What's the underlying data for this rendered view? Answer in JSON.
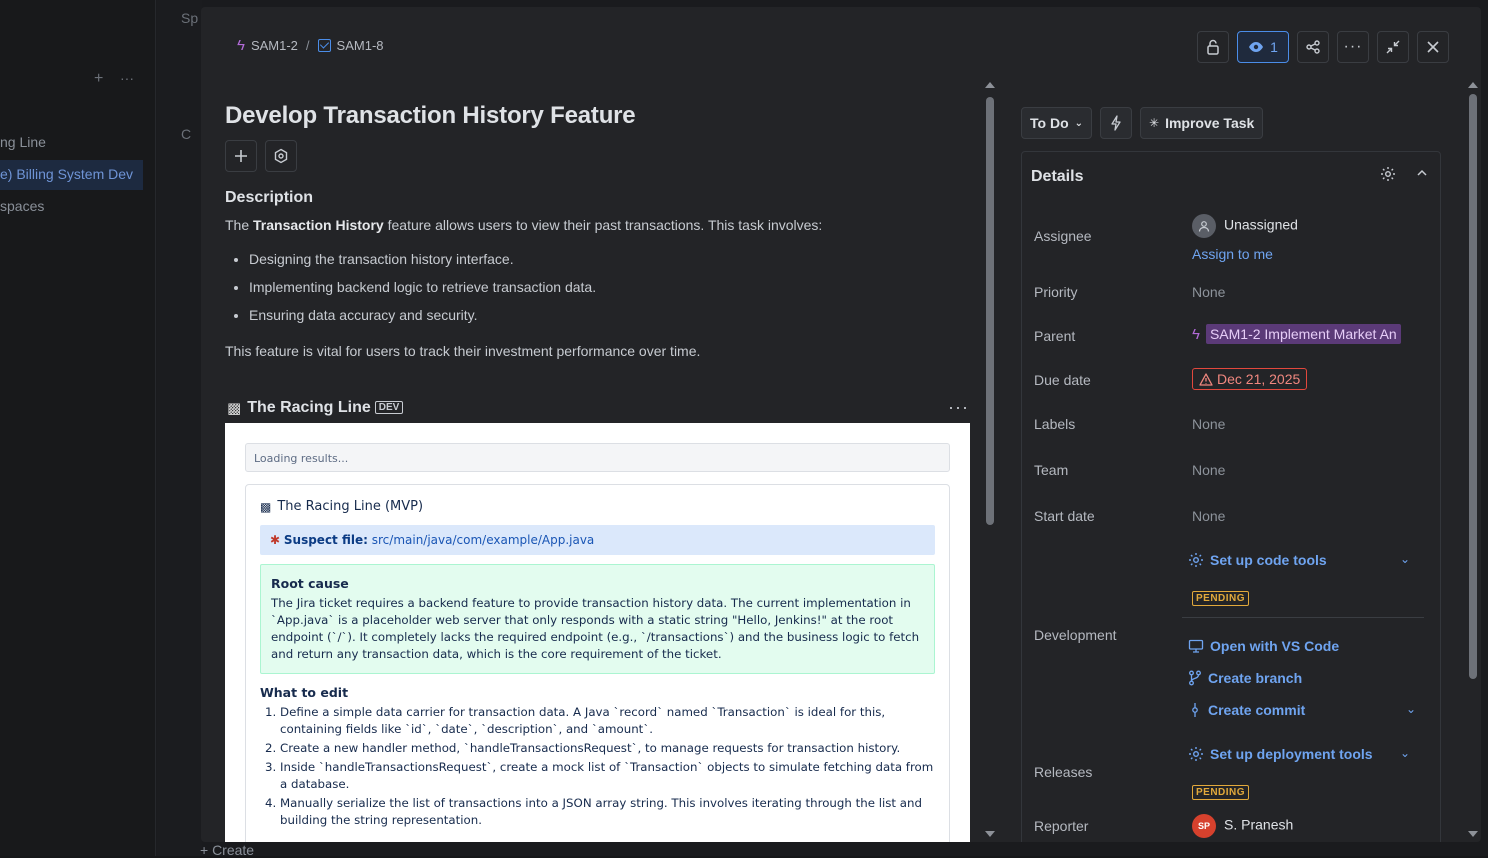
{
  "background": {
    "sidebar_items": [
      "ng Line",
      "e) Billing System Dev",
      "spaces"
    ],
    "col_fragments": [
      "Sp",
      "C"
    ],
    "create_label": "+ Create"
  },
  "breadcrumb": {
    "parent_key": "SAM1-2",
    "separator": "/",
    "current_key": "SAM1-8"
  },
  "toolbar": {
    "watch_count": "1"
  },
  "issue": {
    "title": "Develop Transaction History Feature",
    "description_heading": "Description",
    "intro_prefix": "The ",
    "intro_bold": "Transaction History",
    "intro_suffix": " feature allows users to view their past transactions. This task involves:",
    "bullets": [
      "Designing the transaction history interface.",
      "Implementing backend logic to retrieve transaction data.",
      "Ensuring data accuracy and security."
    ],
    "closing": "This feature is vital for users to track their investment performance over time."
  },
  "racing_line": {
    "title": "The Racing Line",
    "badge": "DEV",
    "loading": "Loading results...",
    "card_title": "The Racing Line (MVP)",
    "suspect_label": "Suspect file:",
    "suspect_path": "src/main/java/com/example/App.java",
    "root_heading": "Root cause",
    "root_text": "The Jira ticket requires a backend feature to provide transaction history data. The current implementation in `App.java` is a placeholder web server that only responds with a static string \"Hello, Jenkins!\" at the root endpoint (`/`). It completely lacks the required endpoint (e.g., `/transactions`) and the business logic to fetch and return any transaction data, which is the core requirement of the ticket.",
    "edit_heading": "What to edit",
    "steps": [
      "Define a simple data carrier for transaction data. A Java `record` named `Transaction` is ideal for this, containing fields like `id`, `date`, `description`, and `amount`.",
      "Create a new handler method, `handleTransactionsRequest`, to manage requests for transaction history.",
      "Inside `handleTransactionsRequest`, create a mock list of `Transaction` objects to simulate fetching data from a database.",
      "Manually serialize the list of transactions into a JSON array string. This involves iterating through the list and building the string representation."
    ]
  },
  "status": {
    "current": "To Do",
    "improve_label": "Improve Task"
  },
  "details": {
    "heading": "Details",
    "assignee_label": "Assignee",
    "assignee_value": "Unassigned",
    "assign_to_me": "Assign to me",
    "priority_label": "Priority",
    "priority_value": "None",
    "parent_label": "Parent",
    "parent_value": "SAM1-2 Implement Market An",
    "due_label": "Due date",
    "due_value": "Dec 21, 2025",
    "labels_label": "Labels",
    "labels_value": "None",
    "team_label": "Team",
    "team_value": "None",
    "start_label": "Start date",
    "start_value": "None",
    "code_tools": "Set up code tools",
    "pending": "PENDING",
    "development_label": "Development",
    "open_vscode": "Open with VS Code",
    "create_branch": "Create branch",
    "create_commit": "Create commit",
    "releases_label": "Releases",
    "deploy_tools": "Set up deployment tools",
    "pending2": "PENDING",
    "reporter_label": "Reporter",
    "reporter_initials": "SP",
    "reporter_name": "S. Pranesh"
  }
}
